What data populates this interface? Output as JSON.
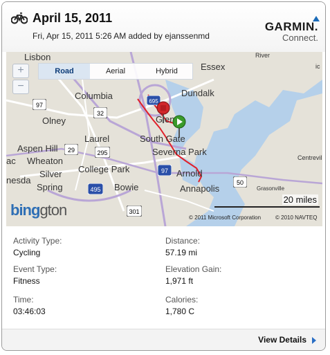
{
  "header": {
    "activity_icon": "bicycle-icon",
    "title": "April 15, 2011",
    "subtitle": "Fri, Apr 15, 2011 5:26 AM added by ejanssenmd",
    "logo_top": "GARMIN.",
    "logo_bottom": "Connect."
  },
  "map": {
    "type_buttons": [
      "Road",
      "Aerial",
      "Hybrid"
    ],
    "active_type": "Road",
    "zoom_in": "+",
    "zoom_out": "−",
    "places": {
      "lisbon": "Lisbon",
      "essex": "Essex",
      "columbia": "Columbia",
      "dundalk": "Dundalk",
      "olney": "Olney",
      "glen": "Glen",
      "laurel": "Laurel",
      "south_gate": "South Gate",
      "aspen_hill": "Aspen Hill",
      "severna_park": "Severna Park",
      "wheaton": "Wheaton",
      "silver": "Silver",
      "spring": "Spring",
      "college_park": "College Park",
      "arnold": "Arnold",
      "bowie": "Bowie",
      "annapolis": "Annapolis",
      "centreville": "Centreville",
      "grasonville": "Grasonville",
      "river": "River",
      "nesda": "nesda",
      "ac": "ac",
      "ic": "ic"
    },
    "highways": [
      "97",
      "32",
      "29",
      "295",
      "495",
      "97",
      "50",
      "301",
      "695"
    ],
    "scale_label": "20 miles",
    "copyright_ms": "© 2011 Microsoft Corporation",
    "copyright_navteq": "© 2010 NAVTEQ",
    "bing_logo": "bing",
    "bing_logo_rest": "gton"
  },
  "stats": {
    "activity_type_label": "Activity Type:",
    "activity_type_value": "Cycling",
    "distance_label": "Distance:",
    "distance_value": "57.19 mi",
    "event_type_label": "Event Type:",
    "event_type_value": "Fitness",
    "elevation_label": "Elevation Gain:",
    "elevation_value": "1,971 ft",
    "time_label": "Time:",
    "time_value": "03:46:03",
    "calories_label": "Calories:",
    "calories_value": "1,780 C"
  },
  "footer": {
    "details_label": "View Details"
  },
  "colors": {
    "route": "#e0202a",
    "start_pin": "#3a9a2a",
    "end_pin": "#d0262a",
    "water": "#b5d0ea",
    "highway": "#b9a6d6",
    "link_arrow": "#2a6ec4"
  }
}
